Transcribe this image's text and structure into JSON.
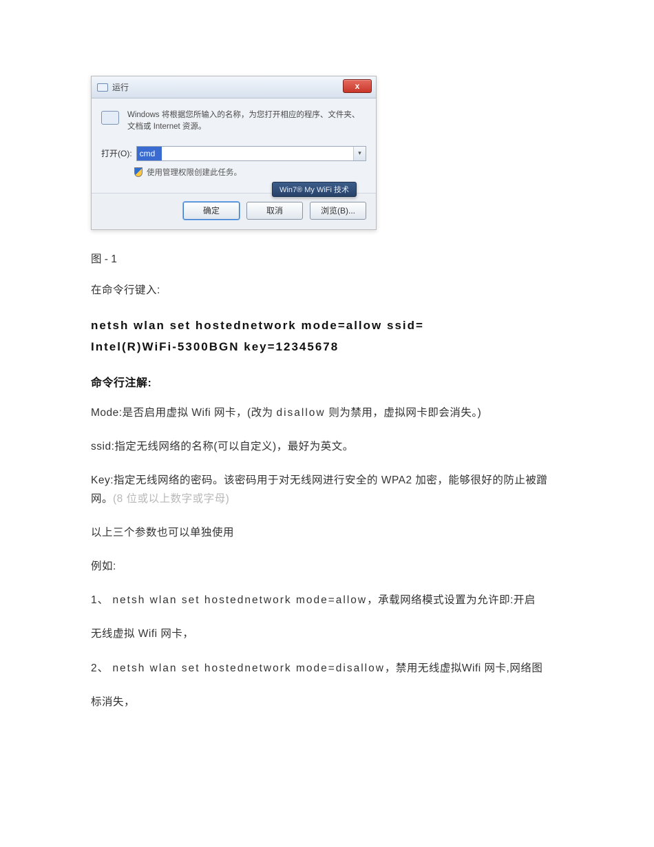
{
  "dialog": {
    "title": "运行",
    "close_glyph": "x",
    "intro": "Windows 将根据您所输入的名称，为您打开相应的程序、文件夹、文档或 Internet 资源。",
    "open_label": "打开(O):",
    "open_value": "cmd",
    "dropdown_glyph": "▾",
    "admin_note": "使用管理权限创建此任务。",
    "tooltip": "Win7® My WiFi 技术",
    "btn_ok": "确定",
    "btn_cancel": "取消",
    "btn_browse": "浏览(B)..."
  },
  "article": {
    "caption": "图 - 1",
    "p_intro": "在命令行键入:",
    "cmd_line1": "netsh wlan set hostednetwork mode=allow ssid=",
    "cmd_line2_a": "Intel(R)WiFi-5300BGN ",
    "cmd_line2_b": "key=12345678",
    "section_title": "命令行注解:",
    "p_mode_a": "Mode:是否启用虚拟 Wifi 网卡，(改为 ",
    "p_mode_b": "disallow",
    "p_mode_c": " 则为禁用，虚拟网卡即会消失。)",
    "p_ssid": "ssid:指定无线网络的名称(可以自定义)，最好为英文。",
    "p_key_a": "Key:指定无线网络的密码。该密码用于对无线网进行安全的 WPA2 加密，能够很好的防止被蹭网。",
    "p_key_gray": "(8 位或以上数字或字母)",
    "p_params": "以上三个参数也可以单独使用",
    "p_eg": "例如:",
    "ex1_num": "1、 ",
    "ex1_cmd": "netsh wlan set hostednetwork mode=allow",
    "ex1_tail": "，承载网络模式设置为允许即:开启",
    "p_wifi_card": "无线虚拟 Wifi 网卡，",
    "ex2_num": "2、 ",
    "ex2_cmd": "netsh wlan set hostednetwork mode=disallow",
    "ex2_tail": "，禁用无线虚拟Wifi 网卡,网络图",
    "p_icon_gone": "标消失，"
  }
}
